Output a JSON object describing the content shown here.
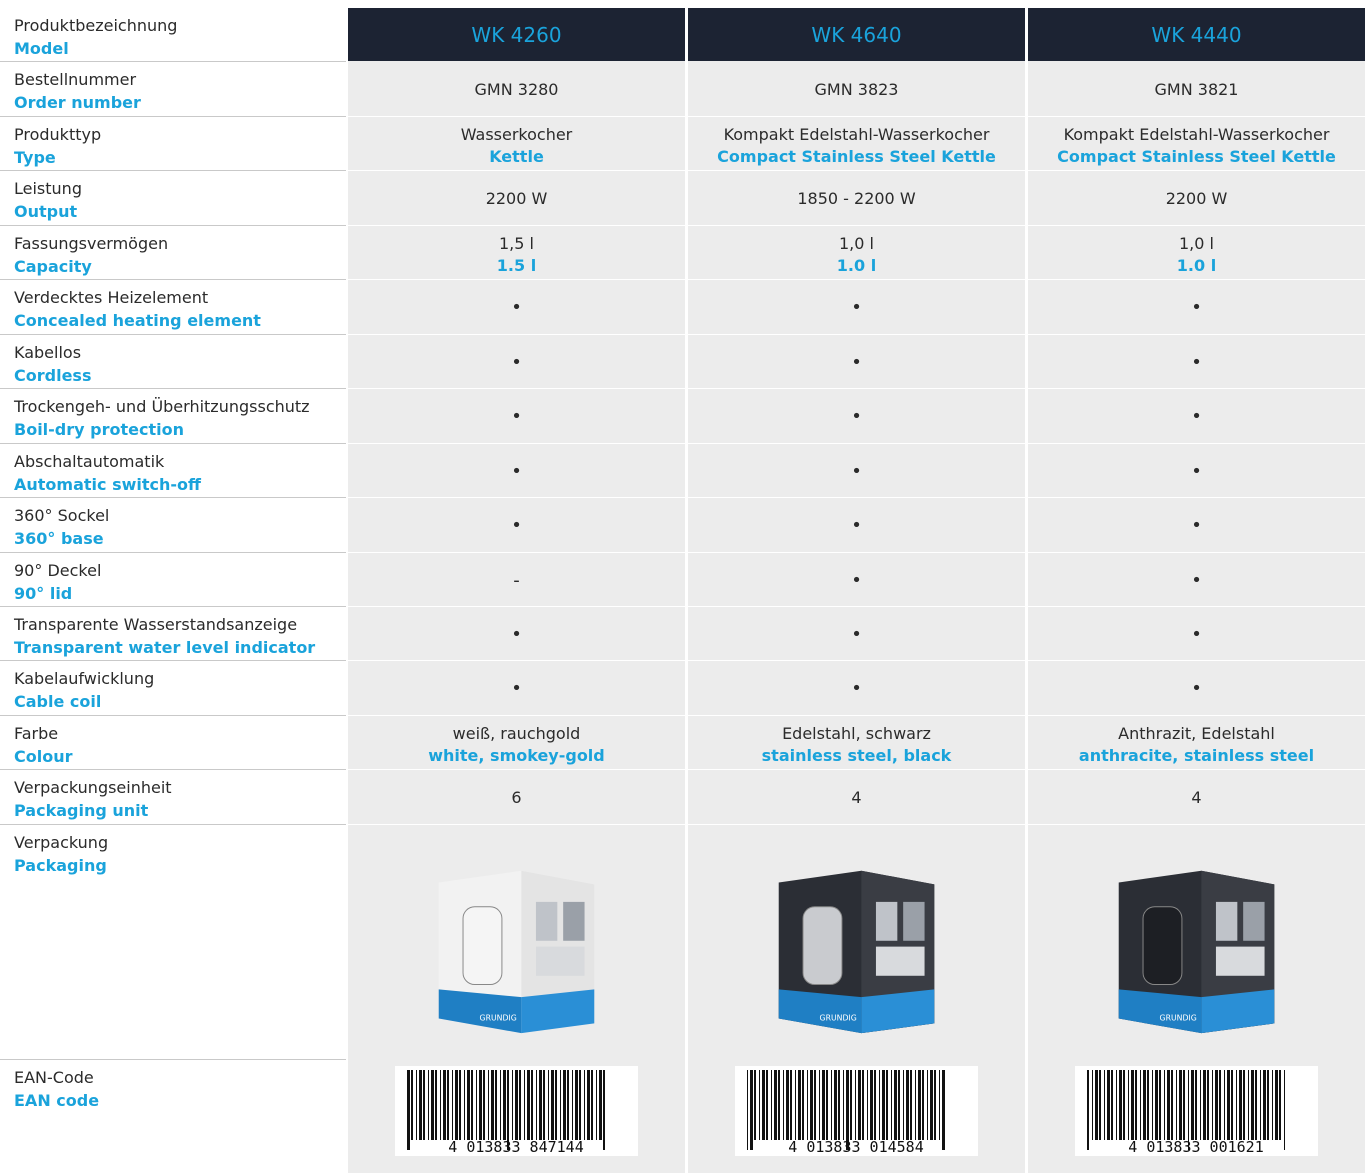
{
  "labels": [
    {
      "de": "Produktbezeichnung",
      "en": "Model"
    },
    {
      "de": "Bestellnummer",
      "en": "Order number"
    },
    {
      "de": "Produkttyp",
      "en": "Type"
    },
    {
      "de": "Leistung",
      "en": "Output"
    },
    {
      "de": "Fassungsvermögen",
      "en": "Capacity"
    },
    {
      "de": "Verdecktes Heizelement",
      "en": "Concealed heating element"
    },
    {
      "de": "Kabellos",
      "en": "Cordless"
    },
    {
      "de": "Trockengeh- und Überhitzungsschutz",
      "en": "Boil-dry protection"
    },
    {
      "de": "Abschaltautomatik",
      "en": "Automatic switch-off"
    },
    {
      "de": "360° Sockel",
      "en": "360° base"
    },
    {
      "de": "90° Deckel",
      "en": "90° lid"
    },
    {
      "de": "Transparente Wasserstandsanzeige",
      "en": "Transparent water level indicator"
    },
    {
      "de": "Kabelaufwicklung",
      "en": "Cable coil"
    },
    {
      "de": "Farbe",
      "en": "Colour"
    },
    {
      "de": "Verpackungseinheit",
      "en": "Packaging unit"
    },
    {
      "de": "Verpackung",
      "en": "Packaging"
    },
    {
      "de": "EAN-Code",
      "en": "EAN code"
    }
  ],
  "products": [
    {
      "model": "WK 4260",
      "order_number": "GMN 3280",
      "type_de": "Wasserkocher",
      "type_en": "Kettle",
      "output": "2200 W",
      "capacity_de": "1,5 l",
      "capacity_en": "1.5 l",
      "concealed": "•",
      "cordless": "•",
      "boil_dry": "•",
      "auto_off": "•",
      "base_360": "•",
      "lid_90": "-",
      "water_level": "•",
      "cable_coil": "•",
      "colour_de": "weiß, rauchgold",
      "colour_en": "white, smokey-gold",
      "packaging_unit": "6",
      "ean": "4 013833 847144"
    },
    {
      "model": "WK 4640",
      "order_number": "GMN 3823",
      "type_de": "Kompakt Edelstahl-Wasserkocher",
      "type_en": "Compact Stainless Steel Kettle",
      "output": "1850 - 2200 W",
      "capacity_de": "1,0 l",
      "capacity_en": "1.0 l",
      "concealed": "•",
      "cordless": "•",
      "boil_dry": "•",
      "auto_off": "•",
      "base_360": "•",
      "lid_90": "•",
      "water_level": "•",
      "cable_coil": "•",
      "colour_de": "Edelstahl, schwarz",
      "colour_en": "stainless steel, black",
      "packaging_unit": "4",
      "ean": "4 013833 014584"
    },
    {
      "model": "WK 4440",
      "order_number": "GMN 3821",
      "type_de": "Kompakt Edelstahl-Wasserkocher",
      "type_en": "Compact Stainless Steel Kettle",
      "output": "2200 W",
      "capacity_de": "1,0 l",
      "capacity_en": "1.0 l",
      "concealed": "•",
      "cordless": "•",
      "boil_dry": "•",
      "auto_off": "•",
      "base_360": "•",
      "lid_90": "•",
      "water_level": "•",
      "cable_coil": "•",
      "colour_de": "Anthrazit, Edelstahl",
      "colour_en": "anthracite, stainless steel",
      "packaging_unit": "4",
      "ean": "4 013833 001621"
    }
  ],
  "brand_on_box": "GRUNDIG",
  "colors": {
    "accent": "#1aa3db",
    "header_bg": "#1c2333",
    "cell_bg": "#ececec"
  }
}
